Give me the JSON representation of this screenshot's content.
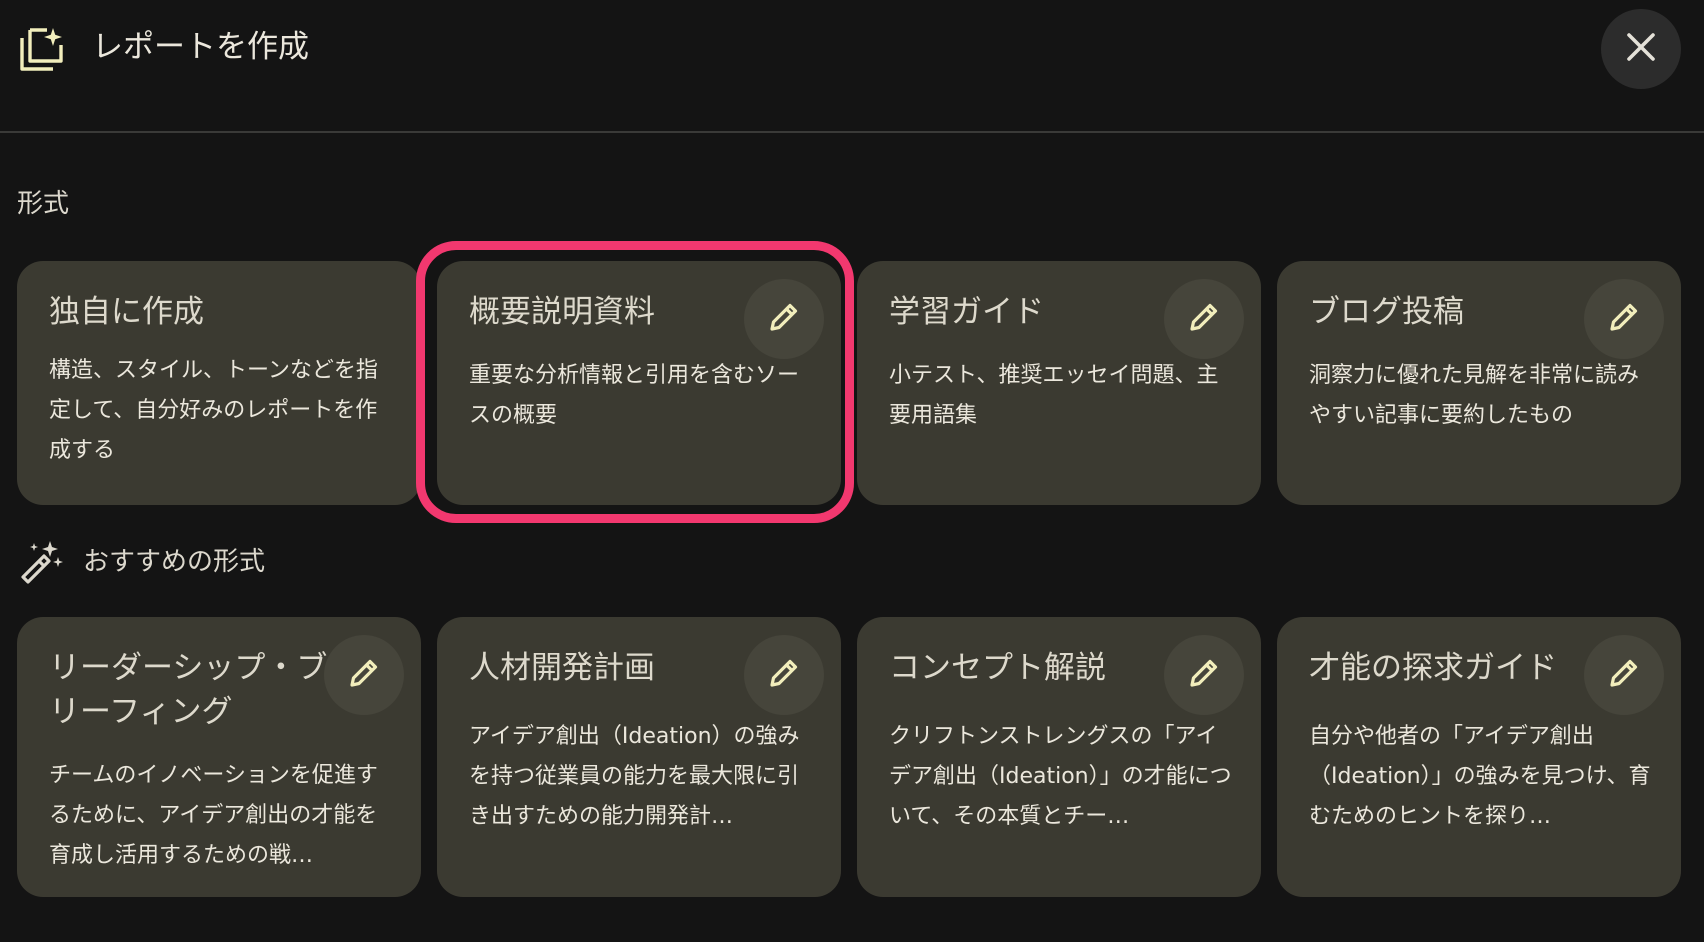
{
  "header": {
    "title": "レポートを作成",
    "icon": "report-sparkle-icon",
    "close_icon": "close-icon"
  },
  "sections": {
    "formats_label": "形式",
    "suggested_label": "おすすめの形式",
    "suggested_icon": "magic-wand-icon"
  },
  "formats": [
    {
      "title": "独自に作成",
      "description": "構造、スタイル、トーンなどを指定して、自分好みのレポートを作成する",
      "editable": false
    },
    {
      "title": "概要説明資料",
      "description": "重要な分析情報と引用を含むソースの概要",
      "editable": true,
      "highlighted": true
    },
    {
      "title": "学習ガイド",
      "description": "小テスト、推奨エッセイ問題、主要用語集",
      "editable": true
    },
    {
      "title": "ブログ投稿",
      "description": "洞察力に優れた見解を非常に読みやすい記事に要約したもの",
      "editable": true
    }
  ],
  "suggested": [
    {
      "title": "リーダーシップ・ブリーフィング",
      "description": "チームのイノベーションを促進するために、アイデア創出の才能を育成し活用するための戦…"
    },
    {
      "title": "人材開発計画",
      "description": "アイデア創出（Ideation）の強みを持つ従業員の能力を最大限に引き出すための能力開発計…"
    },
    {
      "title": "コンセプト解説",
      "description": "クリフトンストレングスの「アイデア創出（Ideation）」の才能について、その本質とチー…"
    },
    {
      "title": "才能の探求ガイド",
      "description": "自分や他者の「アイデア創出（Ideation）」の強みを見つけ、育むためのヒントを探り…"
    }
  ],
  "colors": {
    "background": "#141414",
    "card": "#3b3a31",
    "highlight": "#f2386f",
    "accent_icon": "#f2eebc"
  }
}
